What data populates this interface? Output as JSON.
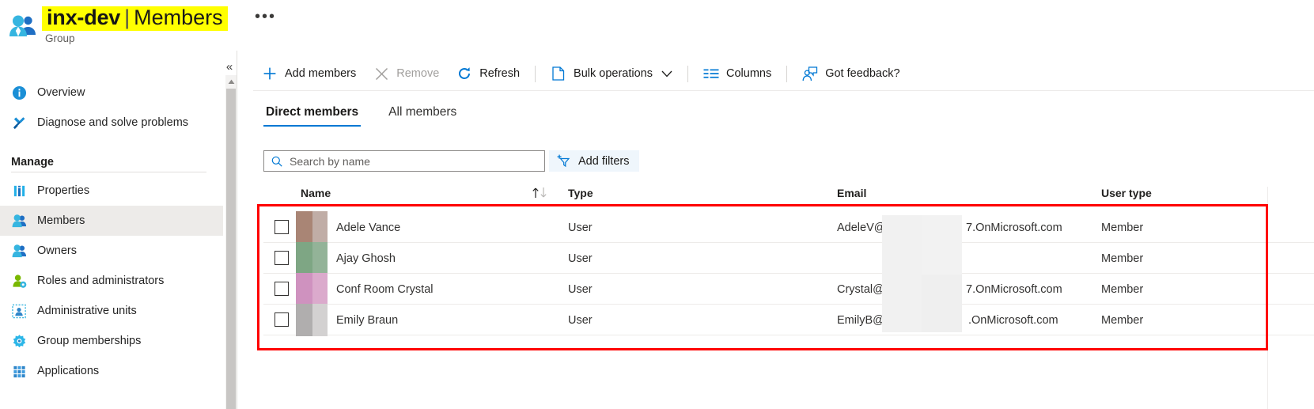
{
  "header": {
    "title_main": "inx-dev",
    "title_separator": "|",
    "title_sub": "Members",
    "subtitle": "Group",
    "ellipsis": "•••",
    "group_icon": "group-people-icon",
    "highlight_color": "#ffff00"
  },
  "sidebar": {
    "collapse_label": "«",
    "items": [
      {
        "label": "Overview",
        "icon": "info-circle-icon",
        "selected": false
      },
      {
        "label": "Diagnose and solve problems",
        "icon": "wrench-screwdriver-icon",
        "selected": false
      }
    ],
    "section_title": "Manage",
    "manage_items": [
      {
        "label": "Properties",
        "icon": "properties-bars-icon",
        "selected": false
      },
      {
        "label": "Members",
        "icon": "members-people-icon",
        "selected": true
      },
      {
        "label": "Owners",
        "icon": "owners-people-icon",
        "selected": false
      },
      {
        "label": "Roles and administrators",
        "icon": "roles-person-gear-icon",
        "selected": false
      },
      {
        "label": "Administrative units",
        "icon": "administrative-units-icon",
        "selected": false
      },
      {
        "label": "Group memberships",
        "icon": "group-memberships-gear-icon",
        "selected": false
      },
      {
        "label": "Applications",
        "icon": "applications-grid-icon",
        "selected": false
      }
    ]
  },
  "toolbar": {
    "add_members": "Add members",
    "remove": "Remove",
    "refresh": "Refresh",
    "bulk_operations": "Bulk operations",
    "columns": "Columns",
    "got_feedback": "Got feedback?",
    "remove_disabled": true
  },
  "tabs": [
    {
      "label": "Direct members",
      "active": true
    },
    {
      "label": "All members",
      "active": false
    }
  ],
  "search": {
    "placeholder": "Search by name",
    "value": "",
    "icon": "search-icon"
  },
  "filters": {
    "add_filters_label": "Add filters",
    "icon": "add-filter-icon",
    "background": "#eff6fc"
  },
  "table": {
    "columns": [
      {
        "key": "name",
        "label": "Name",
        "sortable": true,
        "sort_icon": "sort-ascending-icon"
      },
      {
        "key": "type",
        "label": "Type",
        "sortable": false
      },
      {
        "key": "email",
        "label": "Email",
        "sortable": false
      },
      {
        "key": "user_type",
        "label": "User type",
        "sortable": false
      }
    ],
    "rows": [
      {
        "checked": false,
        "avatar_left": "#a98575",
        "avatar_right": "#c0ada6",
        "name": "Adele Vance",
        "type": "User",
        "email_prefix": "AdeleV@",
        "email_suffix": "7.OnMicrosoft.com",
        "user_type": "Member"
      },
      {
        "checked": false,
        "avatar_left": "#7ea684",
        "avatar_right": "#93b398",
        "name": "Ajay Ghosh",
        "type": "User",
        "email_prefix": "",
        "email_suffix": "",
        "user_type": "Member"
      },
      {
        "checked": false,
        "avatar_left": "#cf92bf",
        "avatar_right": "#dbaacc",
        "name": "Conf Room Crystal",
        "type": "User",
        "email_prefix": "Crystal@",
        "email_suffix": "7.OnMicrosoft.com",
        "user_type": "Member"
      },
      {
        "checked": false,
        "avatar_left": "#b0aeae",
        "avatar_right": "#d3d1d1",
        "name": "Emily Braun",
        "type": "User",
        "email_prefix": "EmilyB@",
        "email_suffix": ".OnMicrosoft.com",
        "user_type": "Member"
      }
    ],
    "redaction": {
      "name": "email-redaction-overlay",
      "color": "#f1f1f1"
    },
    "highlight": {
      "name": "members-table-highlight",
      "color": "#ff0000"
    }
  }
}
